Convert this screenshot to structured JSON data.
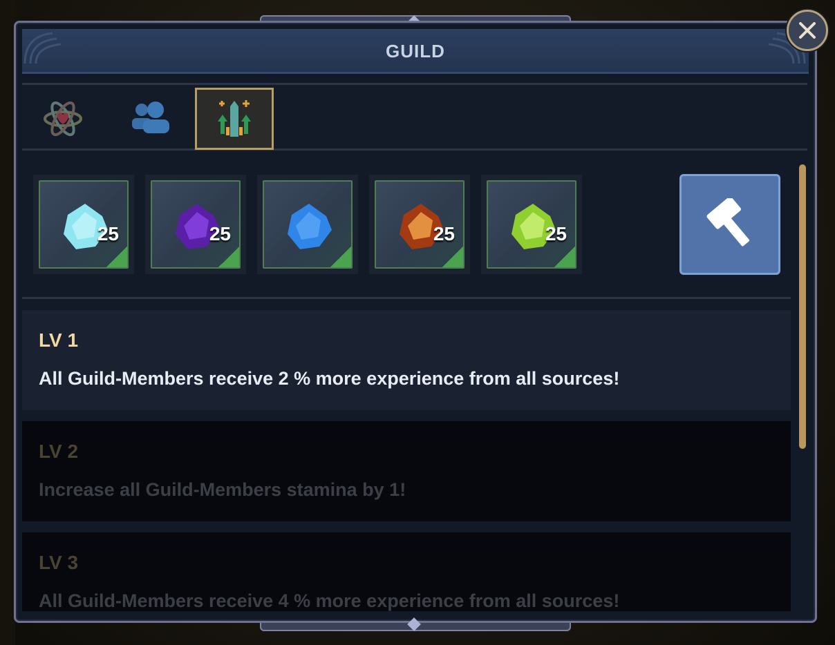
{
  "header": {
    "title": "GUILD"
  },
  "tabs": [
    {
      "icon": "atom-heart-icon",
      "active": false
    },
    {
      "icon": "members-icon",
      "active": false
    },
    {
      "icon": "upgrade-arrows-icon",
      "active": true
    }
  ],
  "resources": [
    {
      "icon": "cyan-crystal-icon",
      "count": "25",
      "color": "#8fe6f0"
    },
    {
      "icon": "purple-crystal-icon",
      "count": "25",
      "color": "#7b2fd6"
    },
    {
      "icon": "blue-crystal-icon",
      "count": "",
      "color": "#2f86e8"
    },
    {
      "icon": "orange-crystal-icon",
      "count": "25",
      "color": "#e07a2e"
    },
    {
      "icon": "green-crystal-icon",
      "count": "25",
      "color": "#a6e045"
    }
  ],
  "upgrade_button": {
    "icon": "hammer-icon"
  },
  "levels": [
    {
      "label": "LV 1",
      "text": "All Guild-Members receive 2 % more experience from all sources!",
      "unlocked": true
    },
    {
      "label": "LV 2",
      "text": "Increase all Guild-Members stamina by 1!",
      "unlocked": false
    },
    {
      "label": "LV 3",
      "text": "All Guild-Members receive 4 % more experience from all sources!",
      "unlocked": false
    }
  ],
  "colors": {
    "accent_gold": "#b79e63",
    "button_blue": "#5173aa",
    "level_title": "#f2d9a0"
  }
}
